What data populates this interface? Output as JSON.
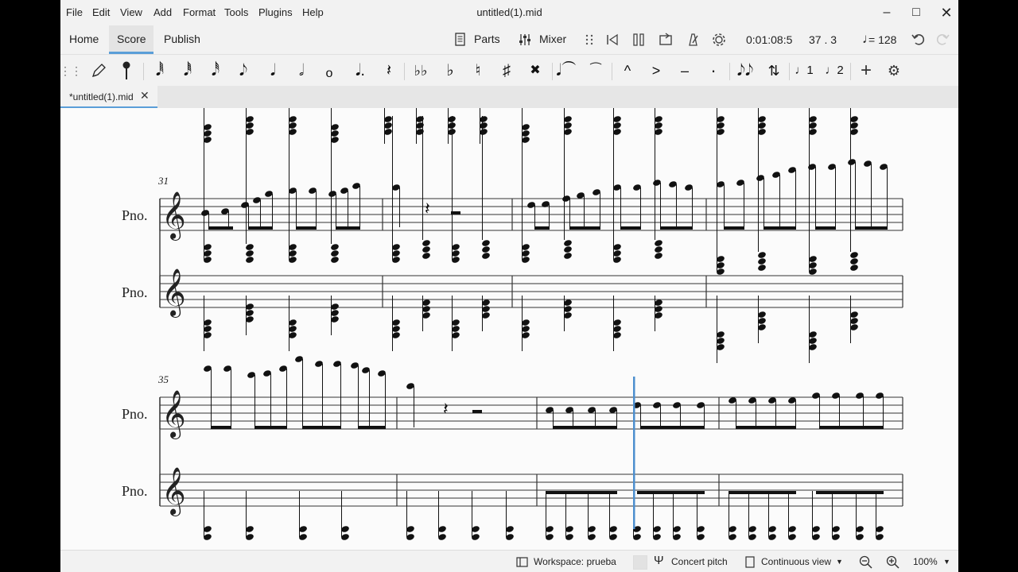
{
  "window": {
    "title": "untitled(1).mid"
  },
  "menu": [
    "File",
    "Edit",
    "View",
    "Add",
    "Format",
    "Tools",
    "Plugins",
    "Help"
  ],
  "nav_tabs": [
    "Home",
    "Score",
    "Publish"
  ],
  "toolbar": {
    "parts_label": "Parts",
    "mixer_label": "Mixer",
    "time": "0:01:08:5",
    "position": "37 . 3",
    "tempo": "= 128"
  },
  "document_tab": {
    "label": "*untitled(1).mid"
  },
  "score": {
    "systems": [
      {
        "measure_number": "31",
        "staves": [
          "Pno.",
          "Pno."
        ]
      },
      {
        "measure_number": "35",
        "staves": [
          "Pno.",
          "Pno."
        ]
      }
    ]
  },
  "status_bar": {
    "workspace": "Workspace: prueba",
    "concert_pitch": "Concert pitch",
    "view_mode": "Continuous view",
    "zoom": "100%"
  }
}
